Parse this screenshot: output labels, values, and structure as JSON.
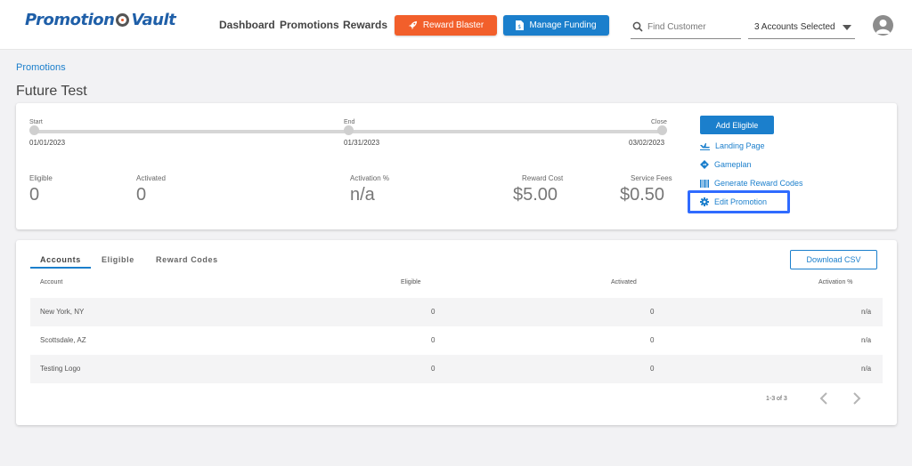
{
  "header": {
    "logo_text_left": "Promotion",
    "logo_text_right": "Vault",
    "nav": [
      "Dashboard",
      "Promotions",
      "Rewards"
    ],
    "reward_blaster_label": "Reward Blaster",
    "reward_blaster_icon": "rocket-icon",
    "manage_funding_label": "Manage Funding",
    "manage_funding_icon": "document-dollar-icon",
    "search_placeholder": "Find Customer",
    "accounts_selected": "3 Accounts Selected"
  },
  "breadcrumb": "Promotions",
  "page_title": "Future Test",
  "timeline": {
    "start_label": "Start",
    "start_date": "01/01/2023",
    "end_label": "End",
    "end_date": "01/31/2023",
    "close_label": "Close",
    "close_date": "03/02/2023"
  },
  "stats": {
    "eligible_label": "Eligible",
    "eligible_value": "0",
    "activated_label": "Activated",
    "activated_value": "0",
    "activation_label": "Activation %",
    "activation_value": "n/a",
    "reward_cost_label": "Reward Cost",
    "reward_cost_value": "$5.00",
    "service_fees_label": "Service Fees",
    "service_fees_value": "$0.50"
  },
  "actions": {
    "add_eligible": "Add Eligible",
    "landing_page": "Landing Page",
    "gameplan": "Gameplan",
    "generate_codes": "Generate Reward Codes",
    "edit_promotion": "Edit Promotion"
  },
  "tabs": [
    "Accounts",
    "Eligible",
    "Reward Codes"
  ],
  "download_csv": "Download CSV",
  "table": {
    "columns": [
      "Account",
      "Eligible",
      "Activated",
      "Activation %"
    ],
    "rows": [
      [
        "New York, NY",
        "0",
        "0",
        "n/a"
      ],
      [
        "Scottsdale, AZ",
        "0",
        "0",
        "n/a"
      ],
      [
        "Testing Logo",
        "0",
        "0",
        "n/a"
      ]
    ]
  },
  "pagination": "1-3 of 3",
  "colors": {
    "primary": "#1b7fcc",
    "reward_blaster": "#f25f2b",
    "highlight": "#2f6bff"
  }
}
